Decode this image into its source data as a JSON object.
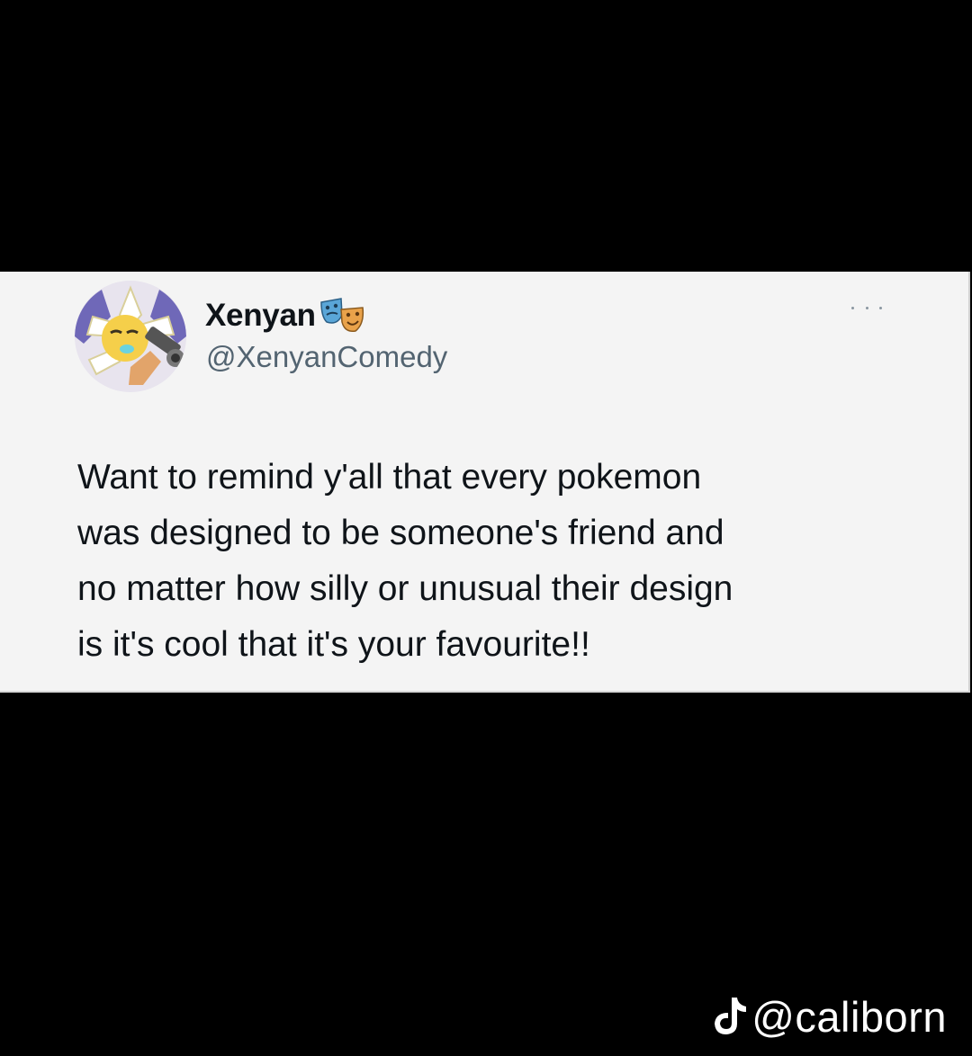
{
  "tweet": {
    "display_name": "Xenyan",
    "display_name_emoji": "performing-arts-masks-icon",
    "handle": "@XenyanComedy",
    "text": "Want to remind y'all that every pokemon\nwas designed to be someone's friend and\nno matter how silly or unusual their design\nis it's cool that it's your favourite!!",
    "more_icon": "more-options-icon"
  },
  "watermark": {
    "platform_icon": "tiktok-logo-icon",
    "handle": "@caliborn"
  },
  "colors": {
    "background": "#000000",
    "card_background": "#f4f4f4",
    "primary_text": "#0f1419",
    "secondary_text": "#536471",
    "watermark_text": "#ffffff"
  }
}
